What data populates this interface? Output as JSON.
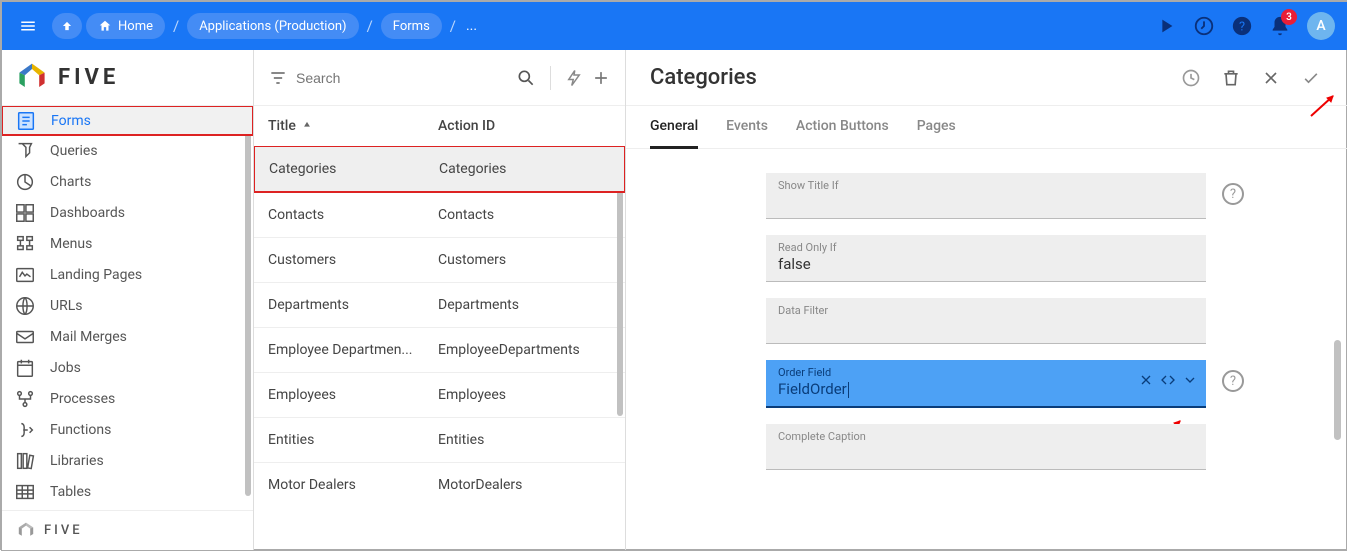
{
  "topbar": {
    "breadcrumb": {
      "home": "Home",
      "applications": "Applications (Production)",
      "forms": "Forms",
      "ellipsis": "..."
    },
    "notification_count": "3",
    "avatar": "A"
  },
  "logo_text": "FIVE",
  "sidebar": {
    "items": [
      {
        "label": "Forms",
        "active": true
      },
      {
        "label": "Queries",
        "active": false
      },
      {
        "label": "Charts",
        "active": false
      },
      {
        "label": "Dashboards",
        "active": false
      },
      {
        "label": "Menus",
        "active": false
      },
      {
        "label": "Landing Pages",
        "active": false
      },
      {
        "label": "URLs",
        "active": false
      },
      {
        "label": "Mail Merges",
        "active": false
      },
      {
        "label": "Jobs",
        "active": false
      },
      {
        "label": "Processes",
        "active": false
      },
      {
        "label": "Functions",
        "active": false
      },
      {
        "label": "Libraries",
        "active": false
      },
      {
        "label": "Tables",
        "active": false
      }
    ],
    "footer": "FIVE"
  },
  "list": {
    "search_placeholder": "Search",
    "header_title": "Title",
    "header_action": "Action ID",
    "rows": [
      {
        "title": "Categories",
        "action": "Categories",
        "selected": true
      },
      {
        "title": "Contacts",
        "action": "Contacts",
        "selected": false
      },
      {
        "title": "Customers",
        "action": "Customers",
        "selected": false
      },
      {
        "title": "Departments",
        "action": "Departments",
        "selected": false
      },
      {
        "title": "Employee Departmen...",
        "action": "EmployeeDepartments",
        "selected": false
      },
      {
        "title": "Employees",
        "action": "Employees",
        "selected": false
      },
      {
        "title": "Entities",
        "action": "Entities",
        "selected": false
      },
      {
        "title": "Motor Dealers",
        "action": "MotorDealers",
        "selected": false
      }
    ]
  },
  "detail": {
    "title": "Categories",
    "tabs": [
      {
        "label": "General",
        "active": true
      },
      {
        "label": "Events",
        "active": false
      },
      {
        "label": "Action Buttons",
        "active": false
      },
      {
        "label": "Pages",
        "active": false
      }
    ],
    "fields": {
      "show_title_if": {
        "label": "Show Title If",
        "value": "",
        "help": true
      },
      "read_only_if": {
        "label": "Read Only If",
        "value": "false",
        "help": false
      },
      "data_filter": {
        "label": "Data Filter",
        "value": "",
        "help": false
      },
      "order_field": {
        "label": "Order Field",
        "value": "FieldOrder",
        "help": true,
        "focus": true
      },
      "complete_caption": {
        "label": "Complete Caption",
        "value": "",
        "help": false
      }
    }
  }
}
